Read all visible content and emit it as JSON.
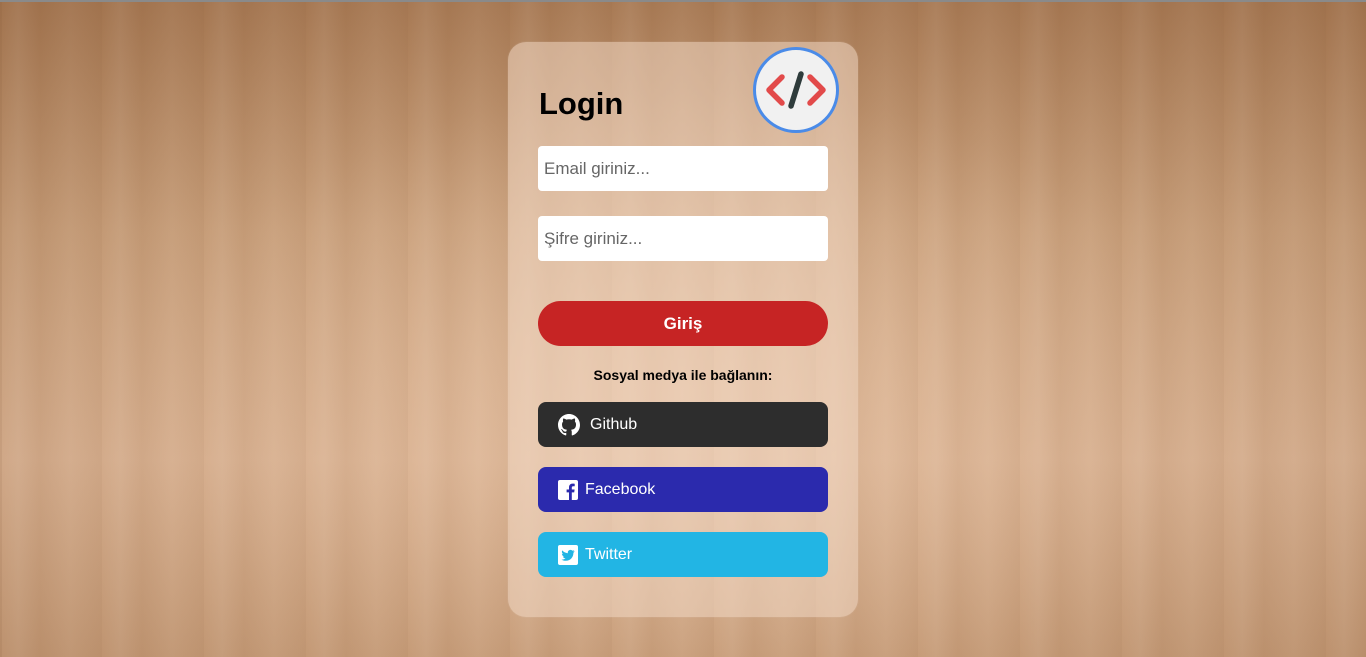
{
  "login": {
    "title": "Login",
    "email_placeholder": "Email giriniz...",
    "password_placeholder": "Şifre giriniz...",
    "submit_label": "Giriş"
  },
  "social": {
    "prompt": "Sosyal medya ile bağlanın:",
    "buttons": [
      {
        "label": "Github",
        "icon": "github-icon",
        "color": "#2d2d2d"
      },
      {
        "label": "Facebook",
        "icon": "facebook-icon",
        "color": "#2b2aad"
      },
      {
        "label": "Twitter",
        "icon": "twitter-icon",
        "color": "#22b5e4"
      }
    ]
  },
  "colors": {
    "accent_red": "#c62424",
    "avatar_border": "#4a8be8"
  }
}
